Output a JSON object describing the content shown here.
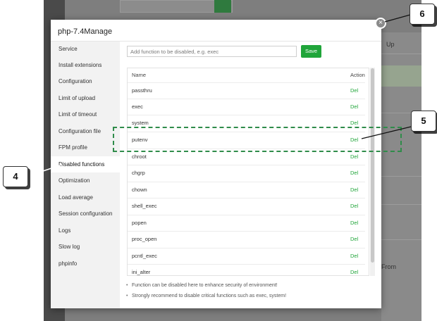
{
  "background": {
    "col_header": "Up",
    "col_text": "From"
  },
  "dialog": {
    "title": "php-7.4Manage",
    "close_icon": "×"
  },
  "sidebar": {
    "items": [
      {
        "label": "Service"
      },
      {
        "label": "Install extensions"
      },
      {
        "label": "Configuration"
      },
      {
        "label": "Limit of upload"
      },
      {
        "label": "Limit of timeout"
      },
      {
        "label": "Configuration file"
      },
      {
        "label": "FPM profile"
      },
      {
        "label": "Disabled functions",
        "active": true
      },
      {
        "label": "Optimization"
      },
      {
        "label": "Load average"
      },
      {
        "label": "Session configuration"
      },
      {
        "label": "Logs"
      },
      {
        "label": "Slow log"
      },
      {
        "label": "phpinfo"
      }
    ]
  },
  "form": {
    "placeholder": "Add function to be disabled, e.g. exec",
    "save_label": "Save"
  },
  "table": {
    "headers": {
      "name": "Name",
      "action": "Action"
    },
    "rows": [
      {
        "name": "passthru",
        "action": "Del"
      },
      {
        "name": "exec",
        "action": "Del"
      },
      {
        "name": "system",
        "action": "Del"
      },
      {
        "name": "putenv",
        "action": "Del"
      },
      {
        "name": "chroot",
        "action": "Del"
      },
      {
        "name": "chgrp",
        "action": "Del"
      },
      {
        "name": "chown",
        "action": "Del"
      },
      {
        "name": "shell_exec",
        "action": "Del"
      },
      {
        "name": "popen",
        "action": "Del"
      },
      {
        "name": "proc_open",
        "action": "Del"
      },
      {
        "name": "pcntl_exec",
        "action": "Del"
      },
      {
        "name": "ini_alter",
        "action": "Del"
      }
    ]
  },
  "tips": [
    "Function can be disabled here to enhance security of environment!",
    "Strongly recommend to disable critical functions such as exec, system!"
  ],
  "callouts": {
    "c4": "4",
    "c5": "5",
    "c6": "6"
  },
  "colors": {
    "accent": "#20a53a",
    "highlight": "#2f8c4a"
  }
}
